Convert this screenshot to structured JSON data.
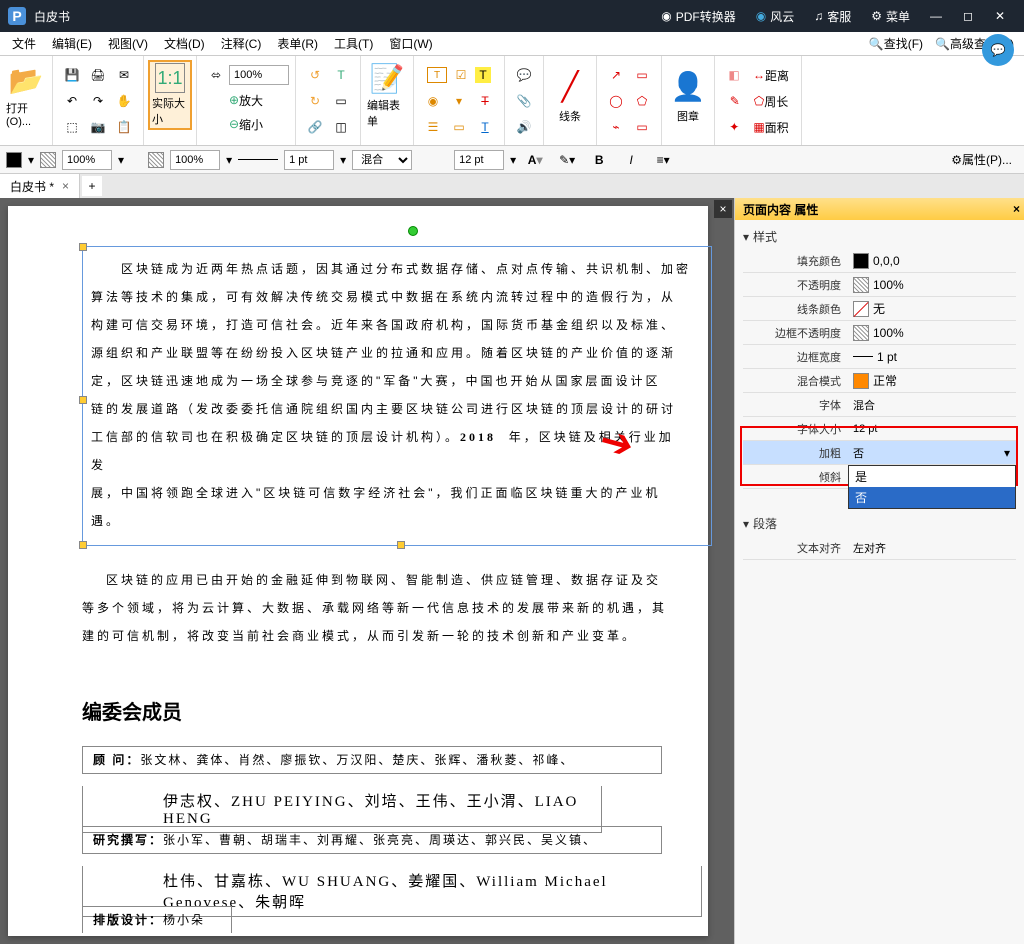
{
  "titlebar": {
    "app": "P",
    "title": "白皮书",
    "btn_pdf": "PDF转换器",
    "btn_fy": "风云",
    "btn_kf": "客服",
    "btn_menu": "菜单"
  },
  "menu": {
    "file": "文件",
    "edit": "编辑(E)",
    "view": "视图(V)",
    "doc": "文档(D)",
    "comment": "注释(C)",
    "form": "表单(R)",
    "tool": "工具(T)",
    "window": "窗口(W)",
    "find": "查找(F)",
    "advfind": "高级查找(S)"
  },
  "toolbar": {
    "open": "打开(O)...",
    "actualsize": "实际大小",
    "zoom": "100%",
    "zoomin": "放大",
    "zoomout": "缩小",
    "editform": "编辑表单",
    "line": "线条",
    "stamp": "图章",
    "distance": "距离",
    "perimeter": "周长",
    "area": "面积"
  },
  "proptool": {
    "pct1": "100%",
    "pct2": "100%",
    "pt": "1 pt",
    "blend": "混合",
    "fontsize": "12 pt",
    "props": "属性(P)..."
  },
  "tab": {
    "name": "白皮书 *"
  },
  "doc": {
    "p1_l1": "区块链成为近两年热点话题，因其通过分布式数据存储、点对点传输、共识机制、加密",
    "p1_l2": "算法等技术的集成，可有效解决传统交易模式中数据在系统内流转过程中的造假行为，从",
    "p1_l3": "构建可信交易环境，打造可信社会。近年来各国政府机构，国际货币基金组织以及标准、",
    "p1_l4": "源组织和产业联盟等在纷纷投入区块链产业的拉通和应用。随着区块链的产业价值的逐渐",
    "p1_l5": "定，区块链迅速地成为一场全球参与竞逐的\"军备\"大赛，中国也开始从国家层面设计区",
    "p1_l6": "链的发展道路（发改委委托信通院组织国内主要区块链公司进行区块链的顶层设计的研讨",
    "p1_l7a": "工信部的信软司也在积极确定区块链的顶层设计机构）。",
    "p1_year": "2018",
    "p1_l7b": "年，区块链及相关行业加",
    "p1_l8": "发",
    "p1_l9": "展，中国将领跑全球进入\"区块链可信数字经济社会\"，我们正面临区块链重大的产业机",
    "p1_l10": "遇。",
    "p2_l1": "区块链的应用已由开始的金融延伸到物联网、智能制造、供应链管理、数据存证及交",
    "p2_l2": "等多个领域，将为云计算、大数据、承载网络等新一代信息技术的发展带来新的机遇，其",
    "p2_l3": "建的可信机制，将改变当前社会商业模式，从而引发新一轮的技术创新和产业变革。",
    "section": "编委会成员",
    "row_gw": "顾    问：",
    "row_gw_v": "张文林、龚体、肖然、廖振钦、万汉阳、楚庆、张辉、潘秋菱、祁峰、",
    "row_gw2": "伊志权、ZHU PEIYING、刘培、王伟、王小渭、LIAO HENG",
    "row_yj": "研究撰写：",
    "row_yj_v": "张小军、曹朝、胡瑞丰、刘再耀、张亮亮、周瑛达、郭兴民、吴义镇、",
    "row_yj2": "杜伟、甘嘉栋、WU SHUANG、姜耀国、William Michael Genovese、朱朝晖",
    "row_pb": "排版设计：",
    "row_pb_v": "杨小朵"
  },
  "properties": {
    "header": "页面内容 属性",
    "style": "样式",
    "paragraph": "段落",
    "fillcolor": "填充颜色",
    "fillcolor_v": "0,0,0",
    "opacity": "不透明度",
    "opacity_v": "100%",
    "linecolor": "线条颜色",
    "linecolor_v": "无",
    "borderopacity": "边框不透明度",
    "borderopacity_v": "100%",
    "borderwidth": "边框宽度",
    "borderwidth_v": "1 pt",
    "blendmode": "混合模式",
    "blendmode_v": "正常",
    "font": "字体",
    "font_v": "混合",
    "fontsize": "字体大小",
    "fontsize_v": "12 pt",
    "bold": "加粗",
    "bold_v": "否",
    "italic": "倾斜",
    "italic_v": "否",
    "opt_yes": "是",
    "opt_no": "否",
    "textalign": "文本对齐",
    "textalign_v": "左对齐"
  }
}
